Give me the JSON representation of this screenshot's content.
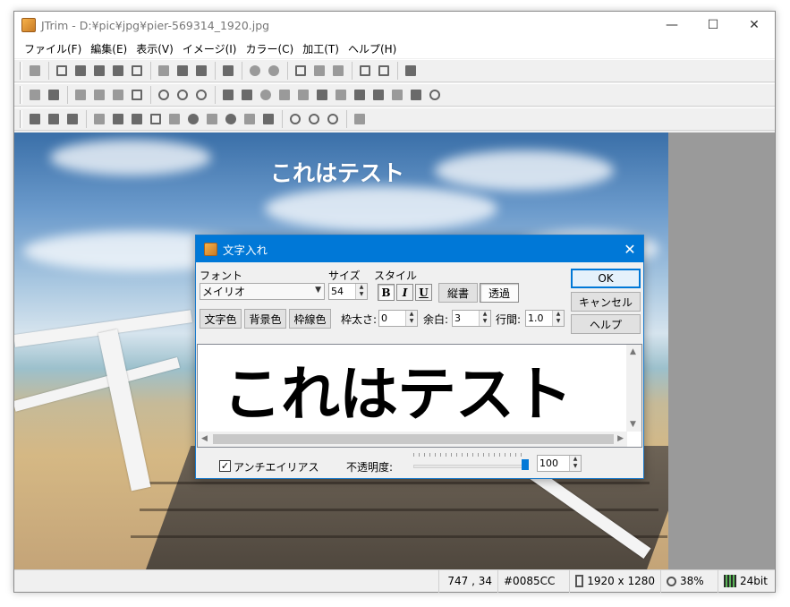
{
  "window": {
    "title": "JTrim - D:¥pic¥jpg¥pier-569314_1920.jpg",
    "controls": {
      "minimize": "—",
      "maximize": "☐",
      "close": "✕"
    }
  },
  "menu": [
    "ファイル(F)",
    "編集(E)",
    "表示(V)",
    "イメージ(I)",
    "カラー(C)",
    "加工(T)",
    "ヘルプ(H)"
  ],
  "canvas": {
    "overlay_text": "これはテスト"
  },
  "dialog": {
    "title": "文字入れ",
    "font_label": "フォント",
    "font_value": "メイリオ",
    "size_label": "サイズ",
    "size_value": "54",
    "style_label": "スタイル",
    "bold": "B",
    "italic": "I",
    "underline": "U",
    "vertical": "縦書",
    "transparent": "透過",
    "text_color": "文字色",
    "bg_color": "背景色",
    "border_color": "枠線色",
    "border_width_label": "枠太さ:",
    "border_width_value": "0",
    "margin_label": "余白:",
    "margin_value": "3",
    "line_spacing_label": "行間:",
    "line_spacing_value": "1.0",
    "ok": "OK",
    "cancel": "キャンセル",
    "help": "ヘルプ",
    "preview_text": "これはテスト",
    "antialias_label": "アンチエイリアス",
    "antialias_checked": true,
    "opacity_label": "不透明度:",
    "opacity_value": "100"
  },
  "status": {
    "coords": "747 , 34",
    "color": "#0085CC",
    "dimensions": "1920 x 1280",
    "zoom": "38%",
    "depth": "24bit"
  }
}
